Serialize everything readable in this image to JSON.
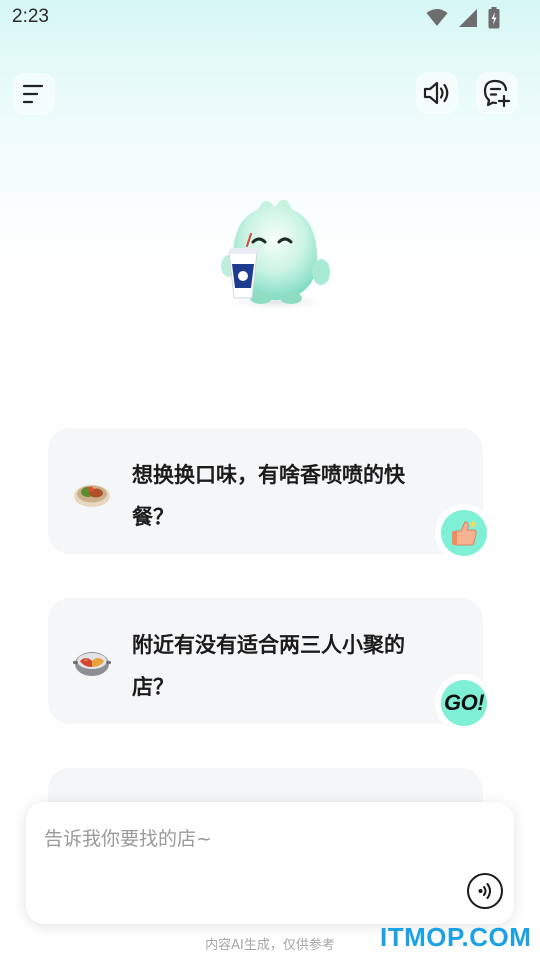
{
  "status_bar": {
    "time": "2:23",
    "icons": [
      "wifi-icon",
      "cellular-signal-icon",
      "battery-charging-icon"
    ]
  },
  "top_bar": {
    "menu_icon": "menu-icon",
    "speaker_icon": "speaker-icon",
    "new_chat_icon": "new-chat-icon"
  },
  "mascot": {
    "icon": "mascot-character"
  },
  "suggestions": [
    {
      "text": "想换换口味，有啥香喷喷的快餐？",
      "icon": "dish-icon",
      "badge": "thumbs-up-icon"
    },
    {
      "text": "附近有没有适合两三人小聚的店？",
      "icon": "hotpot-icon",
      "badge": "GO!"
    },
    {
      "text": ""
    }
  ],
  "input": {
    "placeholder": "告诉我你要找的店~",
    "value": "",
    "voice_icon": "voice-input-icon"
  },
  "disclaimer": "内容AI生成，仅供参考",
  "watermark": "ITMOP.COM",
  "colors": {
    "accent_mint": "#7ff0d6",
    "card_bg": "#f5f6f8",
    "watermark_blue": "#1da1e6"
  }
}
